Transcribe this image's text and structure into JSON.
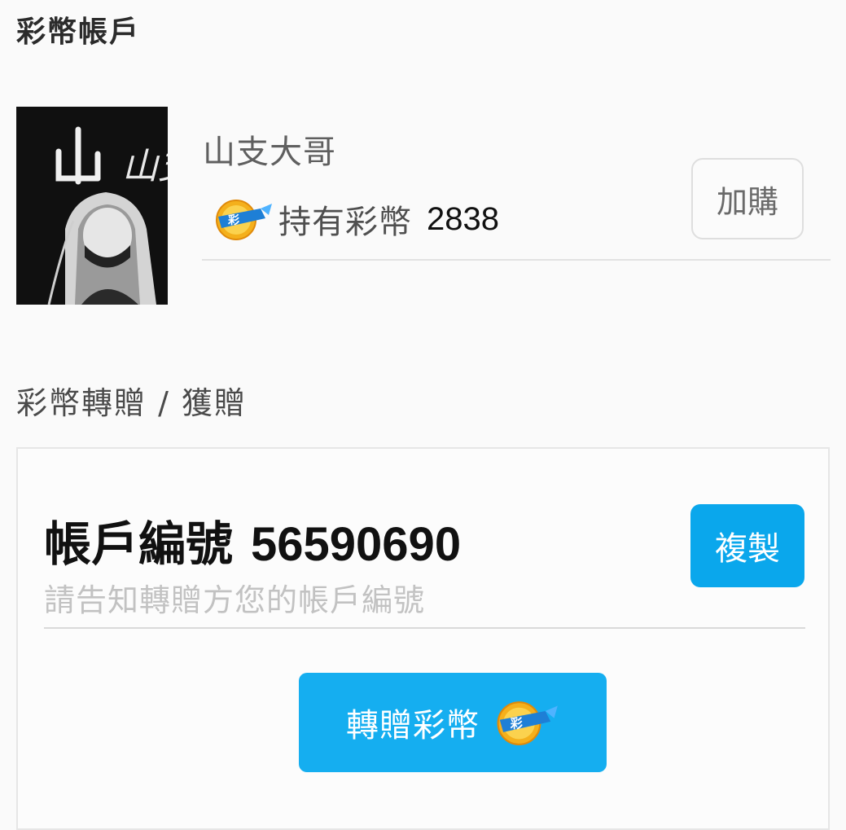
{
  "header": {
    "title": "彩幣帳戶"
  },
  "profile": {
    "name": "山支大哥",
    "coin_label": "持有彩幣",
    "coin_count": "2838",
    "buy_label": "加購",
    "avatar_text": "山支"
  },
  "transfer": {
    "heading": "彩幣轉贈 / 獲贈",
    "account_label": "帳戶編號",
    "account_number": "56590690",
    "hint": "請告知轉贈方您的帳戶編號",
    "copy_label": "複製",
    "gift_label": "轉贈彩幣"
  },
  "icons": {
    "coin": "cai-coin-icon",
    "coin_text": "彩",
    "coin_color": "#f4b01c",
    "coin_badge_color": "#1e7fd6"
  },
  "colors": {
    "accent": "#0aa7ec",
    "accent_bright": "#15aef0"
  }
}
